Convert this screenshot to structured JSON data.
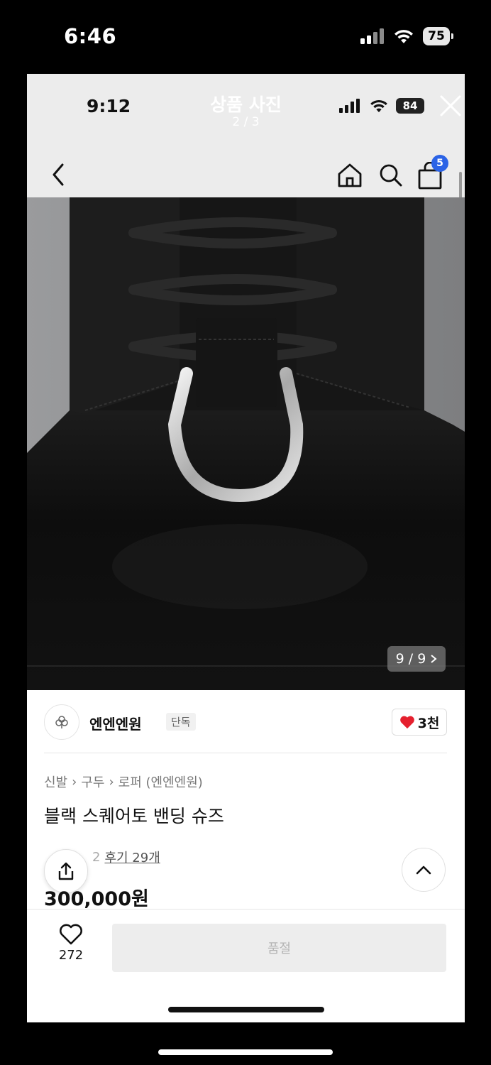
{
  "outer_status": {
    "time": "6:46",
    "battery": "75"
  },
  "viewer": {
    "title": "상품 사진",
    "counter": "2 / 3"
  },
  "inner_status": {
    "time": "9:12",
    "battery": "84"
  },
  "header": {
    "cart_count": "5"
  },
  "image": {
    "counter": "9 / 9"
  },
  "brand": {
    "name": "엔엔엔원",
    "tag": "단독",
    "likes": "3천"
  },
  "breadcrumb": [
    "신발",
    "구두",
    "로퍼 (엔엔엔원)"
  ],
  "product": {
    "title": "블랙 스퀘어토 밴딩 슈즈",
    "rating_hidden": "2",
    "reviews": "후기 29개",
    "price": "300,000원"
  },
  "bottom": {
    "wish_count": "272",
    "sold_out": "품절"
  },
  "colors": {
    "accent_blue": "#2b63e6",
    "heart_red": "#e5202e"
  }
}
